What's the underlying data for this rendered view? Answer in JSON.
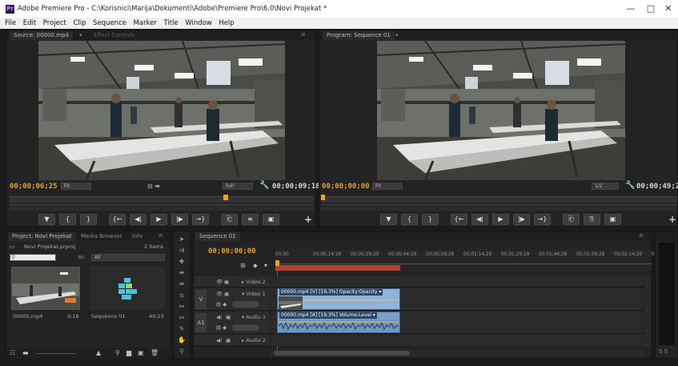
{
  "window": {
    "app_icon": "Pr",
    "title": "Adobe Premiere Pro - C:\\Korisnici\\Marija\\Dokumenti\\Adobe\\Premiere Pro\\6.0\\Novi Projekat *",
    "minimize": "—",
    "maximize": "□",
    "close": "✕"
  },
  "menu": [
    "File",
    "Edit",
    "Project",
    "Clip",
    "Sequence",
    "Marker",
    "Title",
    "Window",
    "Help"
  ],
  "source_monitor": {
    "tab": "Source: 00000.mp4",
    "tab2": "Effect Controls",
    "timecode_current": "00;00;06;25",
    "fit": "Fit",
    "quality": "Full",
    "timecode_duration": "00;00;09;18"
  },
  "program_monitor": {
    "tab": "Program: Sequence 01",
    "timecode_current": "00;00;00;00",
    "fit": "Fit",
    "ratio": "1/2",
    "timecode_duration": "00;00;49;2"
  },
  "transport_icons": [
    "marker-icon",
    "mark-in-icon",
    "mark-out-icon",
    "go-to-in-icon",
    "step-back-icon",
    "play-icon",
    "step-forward-icon",
    "go-to-out-icon",
    "insert-icon",
    "overwrite-icon",
    "export-frame-icon"
  ],
  "transport_glyphs": {
    "source": [
      "▼",
      "{",
      "}",
      "{←",
      "◀|",
      "▶",
      "|▶",
      "→}",
      "⎗",
      "≡",
      "▣"
    ],
    "program": [
      "▼",
      "{",
      "}",
      "{←",
      "◀|",
      "▶",
      "|▶",
      "→}",
      "⎗",
      "⎘",
      "▣"
    ]
  },
  "project": {
    "tabs": [
      "Project: Novi Projekat",
      "Media Browser",
      "Info"
    ],
    "file": "Novi Projekat.prproj",
    "item_count": "2 Items",
    "search_placeholder": "",
    "filter_label": "In:",
    "filter_value": "All",
    "items": [
      {
        "name": "00000.mp4",
        "duration": "9;18"
      },
      {
        "name": "Sequence 01",
        "duration": "49;23"
      }
    ]
  },
  "timeline": {
    "tab": "Sequence 01",
    "timecode": "00;00;00;00",
    "ruler_labels": [
      "00;00",
      "00;00;14;29",
      "00;00;29;29",
      "00;00;44;28",
      "00;00;59;28",
      "00;01;14;29",
      "00;01;29;29",
      "00;01;44;28",
      "00;01;59;28",
      "00;02;14;29",
      "00;"
    ],
    "tracks": [
      {
        "name": "Video 2",
        "type": "video"
      },
      {
        "name": "Video 1",
        "type": "video",
        "target": "V"
      },
      {
        "name": "Audio 1",
        "type": "audio",
        "target": "A1"
      },
      {
        "name": "Audio 2",
        "type": "audio"
      }
    ],
    "video_clip_label": "00000.mp4 [V] [19,3%]  Opacity:Opacity ▾",
    "audio_clip_label": "00000.mp4 [A] [19,3%]  Volume:Level ▾"
  },
  "colors": {
    "timecode_orange": "#e8a02a",
    "playhead": "#e8a02a",
    "clip_video": "#8fb3d9",
    "clip_audio": "#7aa0c8",
    "work_area": "#b3442a"
  }
}
